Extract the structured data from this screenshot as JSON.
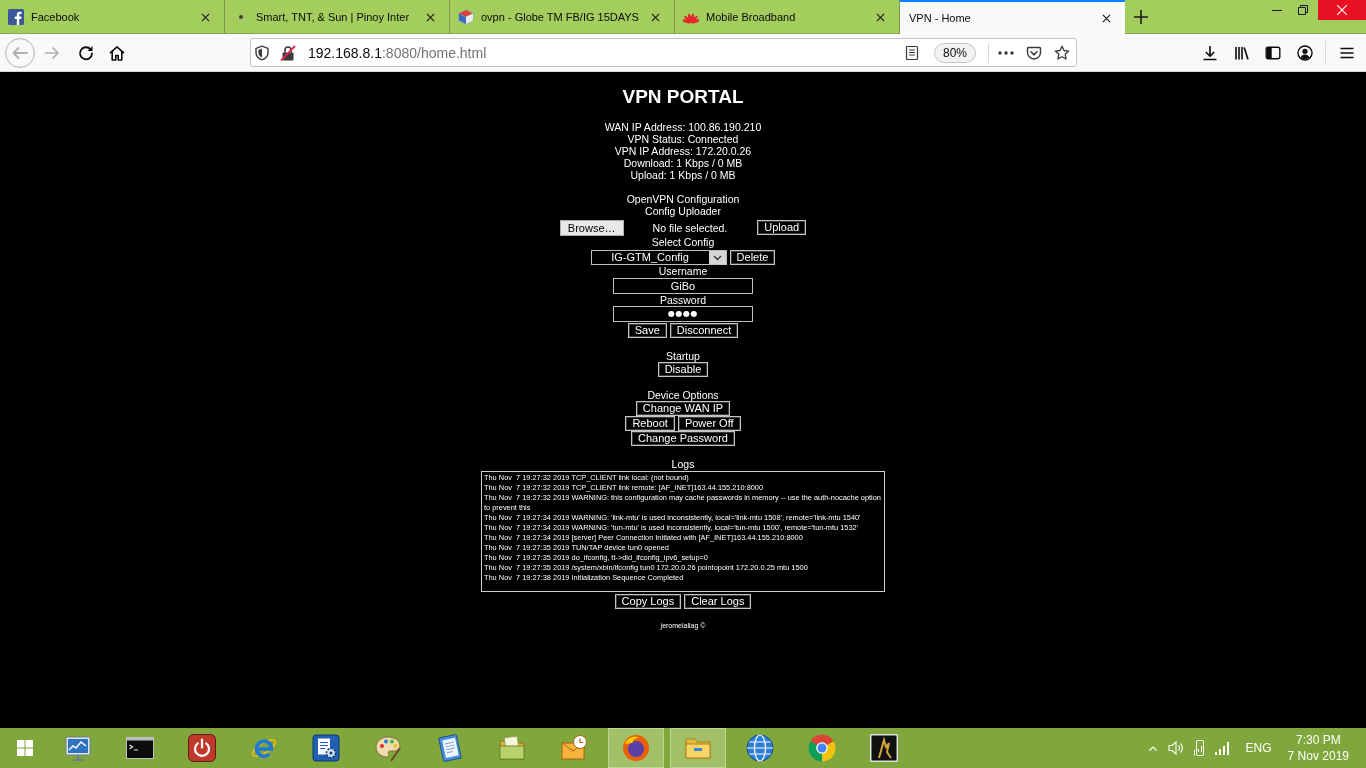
{
  "browser": {
    "tabs": [
      {
        "label": "Facebook",
        "kind": "flogo",
        "selected": false
      },
      {
        "label": "Smart, TNT, & Sun | Pinoy Inter",
        "kind": "dot",
        "selected": false
      },
      {
        "label": "ovpn - Globe TM FB/IG 15DAYS",
        "kind": "cube",
        "selected": false
      },
      {
        "label": "Mobile Broadband",
        "kind": "petals",
        "selected": false
      },
      {
        "label": "VPN - Home",
        "kind": "none",
        "selected": true
      }
    ],
    "nav_buttons": [
      {
        "kind": "back",
        "disabled": true
      },
      {
        "kind": "forward",
        "disabled": true
      },
      {
        "kind": "reload",
        "disabled": false
      },
      {
        "kind": "home",
        "disabled": false
      }
    ],
    "address": {
      "host": "192.168.8.1",
      "path": ":8080/home.html",
      "zoom": "80%"
    }
  },
  "page": {
    "title": "VPN PORTAL",
    "status": [
      "WAN IP Address: 100.86.190.210",
      "VPN Status: Connected",
      "VPN IP Address: 172.20.0.26",
      "Download: 1 Kbps / 0 MB",
      "Upload: 1 Kbps / 0 MB"
    ],
    "config": {
      "heading": "OpenVPN Configuration",
      "uploader_label": "Config Uploader",
      "browse_button": "Browse…",
      "file_status": "No file selected.",
      "upload_button": "Upload",
      "select_label": "Select Config",
      "selected_config": "IG-GTM_Config",
      "delete_button": "Delete",
      "username_label": "Username",
      "username": "GiBo",
      "password_label": "Password",
      "password": "●●●●",
      "buttons": [
        "Save",
        "Disconnect"
      ]
    },
    "startup": {
      "label": "Startup",
      "button": "Disable"
    },
    "device_options": {
      "label": "Device Options",
      "button_rows": [
        [
          "Change WAN IP"
        ],
        [
          "Reboot",
          "Power Off"
        ],
        [
          "Change Password"
        ]
      ]
    },
    "logs": {
      "label": "Logs",
      "lines": [
        "Thu Nov  7 19:27:32 2019 TCP_CLIENT link local: (not bound)",
        "Thu Nov  7 19:27:32 2019 TCP_CLIENT link remote: [AF_INET]163.44.155.210:8000",
        "Thu Nov  7 19:27:32 2019 WARNING: this configuration may cache passwords in memory -- use the auth-nocache option to prevent this",
        "Thu Nov  7 19:27:34 2019 WARNING: 'link-mtu' is used inconsistently, local='link-mtu 1508', remote='link-mtu 1540'",
        "Thu Nov  7 19:27:34 2019 WARNING: 'tun-mtu' is used inconsistently, local='tun-mtu 1500', remote='tun-mtu 1532'",
        "Thu Nov  7 19:27:34 2019 [server] Peer Connection Initiated with [AF_INET]163.44.155.210:8000",
        "Thu Nov  7 19:27:35 2019 TUN/TAP device tun0 opened",
        "Thu Nov  7 19:27:35 2019 do_ifconfig, tt->did_ifconfig_ipv6_setup=0",
        "Thu Nov  7 19:27:35 2019 /system/xbin/ifconfig tun0 172.20.0.26 pointopoint 172.20.0.25 mtu 1500",
        "Thu Nov  7 19:27:38 2019 Initialization Sequence Completed"
      ],
      "buttons": [
        "Copy Logs",
        "Clear Logs"
      ]
    },
    "footer": "jeromelaliag ©"
  },
  "taskbar": {
    "apps": [
      {
        "kind": "monitor",
        "active": false
      },
      {
        "kind": "terminal",
        "active": false
      },
      {
        "kind": "power",
        "active": false
      },
      {
        "kind": "ebrowser",
        "active": false
      },
      {
        "kind": "docgear",
        "active": false
      },
      {
        "kind": "palette",
        "active": false
      },
      {
        "kind": "notepad",
        "active": false
      },
      {
        "kind": "notes",
        "active": false
      },
      {
        "kind": "mail",
        "active": false
      },
      {
        "kind": "flameglobe",
        "active": true
      },
      {
        "kind": "folder",
        "active": true
      },
      {
        "kind": "globe",
        "active": false
      },
      {
        "kind": "ringlogo",
        "active": false
      },
      {
        "kind": "figure",
        "active": false
      }
    ],
    "language": "ENG",
    "time": "7:30 PM",
    "date": "7 Nov 2019"
  }
}
